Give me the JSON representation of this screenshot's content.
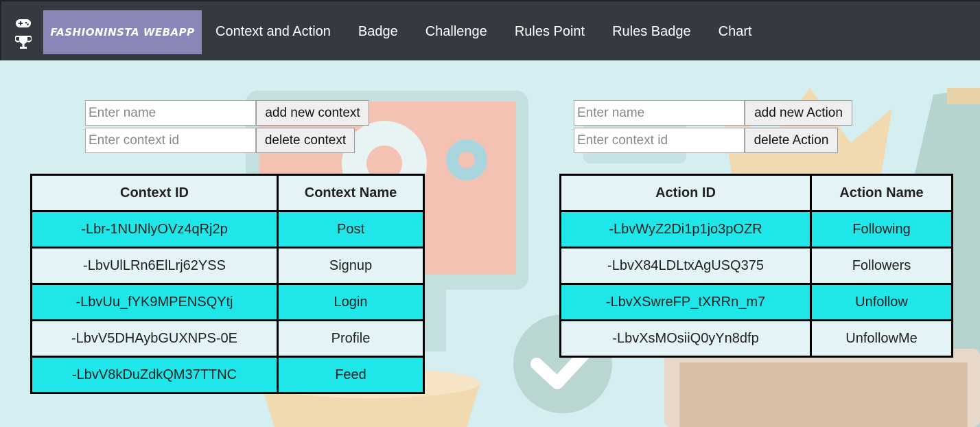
{
  "navbar": {
    "brand": "FASHIONINSTA WEBAPP",
    "links": [
      "Context and Action",
      "Badge",
      "Challenge",
      "Rules Point",
      "Rules Badge",
      "Chart"
    ],
    "icons": [
      "gamepad-icon",
      "trophy-icon"
    ]
  },
  "context_panel": {
    "name_placeholder": "Enter name",
    "add_label": "add new context",
    "id_placeholder": "Enter context id",
    "delete_label": "delete context",
    "headers": [
      "Context ID",
      "Context Name"
    ],
    "rows": [
      {
        "id": "-Lbr-1NUNlyOVz4qRj2p",
        "name": "Post"
      },
      {
        "id": "-LbvUlLRn6ElLrj62YSS",
        "name": "Signup"
      },
      {
        "id": "-LbvUu_fYK9MPENSQYtj",
        "name": "Login"
      },
      {
        "id": "-LbvV5DHAybGUXNPS-0E",
        "name": "Profile"
      },
      {
        "id": "-LbvV8kDuZdkQM37TTNC",
        "name": "Feed"
      }
    ]
  },
  "action_panel": {
    "name_placeholder": "Enter name",
    "add_label": "add new Action",
    "id_placeholder": "Enter context id",
    "delete_label": "delete Action",
    "headers": [
      "Action ID",
      "Action Name"
    ],
    "rows": [
      {
        "id": "-LbvWyZ2Di1p1jo3pOZR",
        "name": "Following"
      },
      {
        "id": "-LbvX84LDLtxAgUSQ375",
        "name": "Followers"
      },
      {
        "id": "-LbvXSwreFP_tXRRn_m7",
        "name": "Unfollow"
      },
      {
        "id": "-LbvXsMOsiiQ0yYn8dfp",
        "name": "UnfollowMe"
      }
    ]
  },
  "colors": {
    "navbar": "#343a40",
    "brand": "#8a86b8",
    "row_highlight": "#1fe6e8",
    "page_bg": "#d5eef1"
  }
}
